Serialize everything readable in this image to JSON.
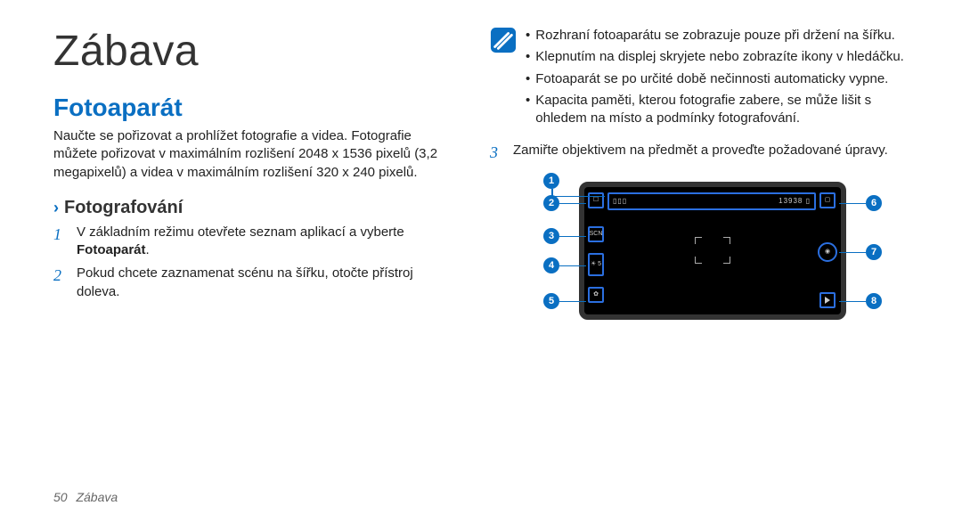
{
  "title": "Zábava",
  "section": "Fotoaparát",
  "intro": "Naučte se pořizovat a prohlížet fotografie a videa. Fotografie můžete pořizovat v maximálním rozlišení 2048 x 1536 pixelů (3,2 megapixelů) a videa v maximálním rozlišení 320 x 240 pixelů.",
  "subsection": "Fotografování",
  "steps": {
    "s1a": "V základním režimu otevřete seznam aplikací a vyberte ",
    "s1b": "Fotoaparát",
    "s1c": ".",
    "s2": "Pokud chcete zaznamenat scénu na šířku, otočte přístroj doleva.",
    "s3": "Zamiřte objektivem na předmět a proveďte požadované úpravy."
  },
  "notes": {
    "n1": "Rozhraní fotoaparátu se zobrazuje pouze při držení na šířku.",
    "n2": "Klepnutím na displej skryjete nebo zobrazíte ikony v hledáčku.",
    "n3": "Fotoaparát se po určité době nečinnosti automaticky vypne.",
    "n4": "Kapacita paměti, kterou fotografie zabere, se může lišit s ohledem na místo a podmínky fotografování."
  },
  "camera_ui": {
    "topbar_left": "▯▯▯",
    "topbar_right": "13938 ▯",
    "icon_switch": "☐",
    "icon_scn": "SCN",
    "icon_exp": "☀ 5",
    "icon_gear": "✿",
    "icon_thumb": "▢",
    "icon_shutter": "◉",
    "icon_play": "▶"
  },
  "callouts": {
    "c1": "1",
    "c2": "2",
    "c3": "3",
    "c4": "4",
    "c5": "5",
    "c6": "6",
    "c7": "7",
    "c8": "8"
  },
  "footer": {
    "page": "50",
    "label": "Zábava"
  }
}
